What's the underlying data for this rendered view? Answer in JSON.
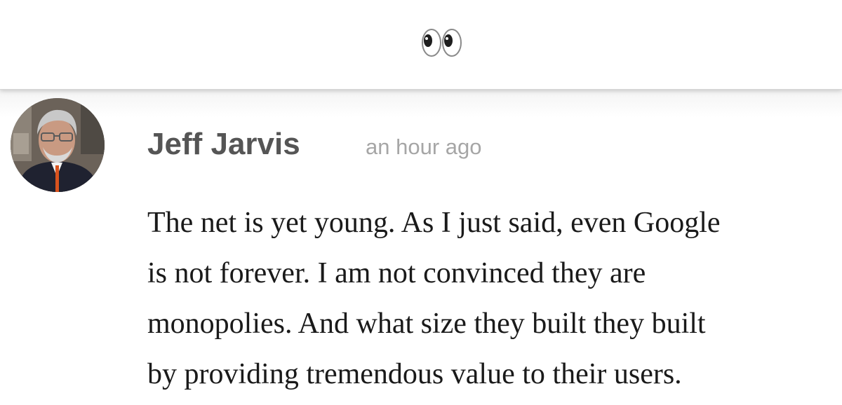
{
  "header": {
    "icon": "eyes-emoji-icon"
  },
  "comment": {
    "author": "Jeff Jarvis",
    "timestamp": "an hour ago",
    "avatar_icon": "user-avatar",
    "lines": [
      "The net is yet young. As I just said, even Google",
      "is not forever. I am not convinced they are",
      "monopolies. And what size they built they built",
      "by providing tremendous value to their users."
    ]
  }
}
